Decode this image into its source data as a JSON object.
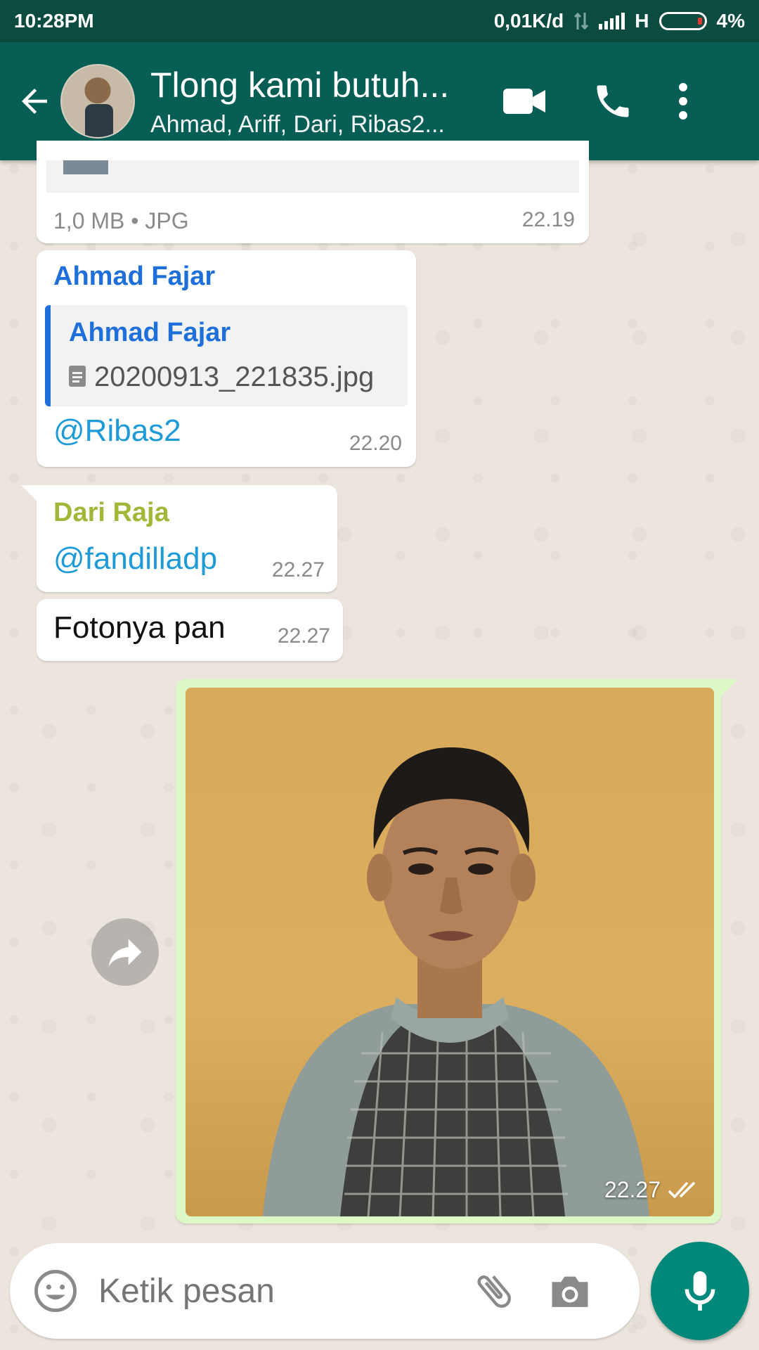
{
  "status_bar": {
    "time": "10:28PM",
    "network_speed": "0,01K/d",
    "network_type": "H",
    "battery": "4%"
  },
  "header": {
    "title": "Tlong kami butuh...",
    "subtitle": "Ahmad, Ariff, Dari, Ribas2..."
  },
  "messages": {
    "file_msg": {
      "meta": "1,0 MB • JPG",
      "time": "22.19"
    },
    "reply_msg": {
      "sender": "Ahmad Fajar",
      "quoted_sender": "Ahmad Fajar",
      "quoted_file": "20200913_221835.jpg",
      "text": "@Ribas2",
      "time": "22.20"
    },
    "dari_msg": {
      "sender": "Dari Raja",
      "text": "@fandilladp",
      "time": "22.27"
    },
    "dari_msg2": {
      "text": "Fotonya pan",
      "time": "22.27"
    },
    "photo_msg": {
      "time": "22.27"
    }
  },
  "input": {
    "placeholder": "Ketik pesan"
  },
  "colors": {
    "header": "#075e54",
    "statusbar": "#0b4b40",
    "outgoing_bubble": "#dcf8c6",
    "sender_blue": "#1e6fd9",
    "sender_green": "#a3b637",
    "mention": "#1e9bd7",
    "mic": "#00897b"
  }
}
